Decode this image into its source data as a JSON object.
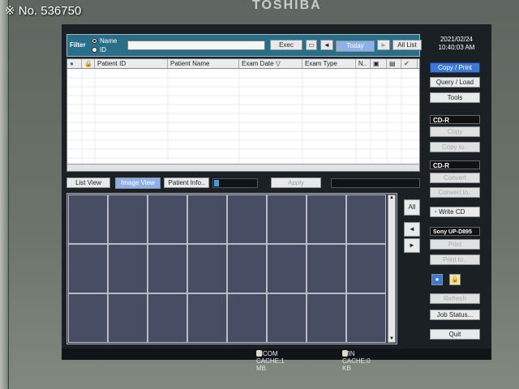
{
  "watermark": "※ No. 536750",
  "brand": "TOSHIBA",
  "filter": {
    "label": "Filter",
    "radio_name": "Name",
    "radio_id": "ID",
    "input_value": "",
    "exec": "Exec",
    "prev_arrow": "◄",
    "today": "Today",
    "next_arrow": "►",
    "all_list": "All List"
  },
  "datetime": {
    "date": "2021/02/24",
    "time": "10:40:03 AM"
  },
  "table": {
    "columns": [
      "",
      "",
      "Patient ID",
      "Patient Name",
      "Exam Date ▽",
      "Exam Type",
      "N..",
      "",
      "",
      ""
    ],
    "rows": []
  },
  "view_tabs": {
    "list_view": "List View",
    "image_view": "Image View",
    "patient_info": "Patient Info..",
    "apply": "Apply"
  },
  "image_nav": {
    "all": "All",
    "prev": "◄",
    "next": "►"
  },
  "right_panel": {
    "copy_print": "Copy / Print",
    "query_load": "Query / Load",
    "tools": "Tools",
    "cdr1_header": "CD-R",
    "copy": "Copy",
    "copy_to": "Copy to..",
    "cdr2_header": "CD-R",
    "convert": "Convert",
    "convert_to": "Convert to..",
    "write_cd": "Write CD",
    "printer_header": "Sony UP-D895",
    "print": "Print",
    "print_to": "Print to..",
    "refresh": "Refresh",
    "job_status": "Job Status...",
    "quit": "Quit"
  },
  "status": {
    "dicom_cache": "DICOM CACHE:1 MB",
    "win_cache": "WIN CACHE:0 KB"
  },
  "colors": {
    "accent": "#3c78d6",
    "filter_bar": "#2a6f8a",
    "image_cell": "#474e63"
  }
}
